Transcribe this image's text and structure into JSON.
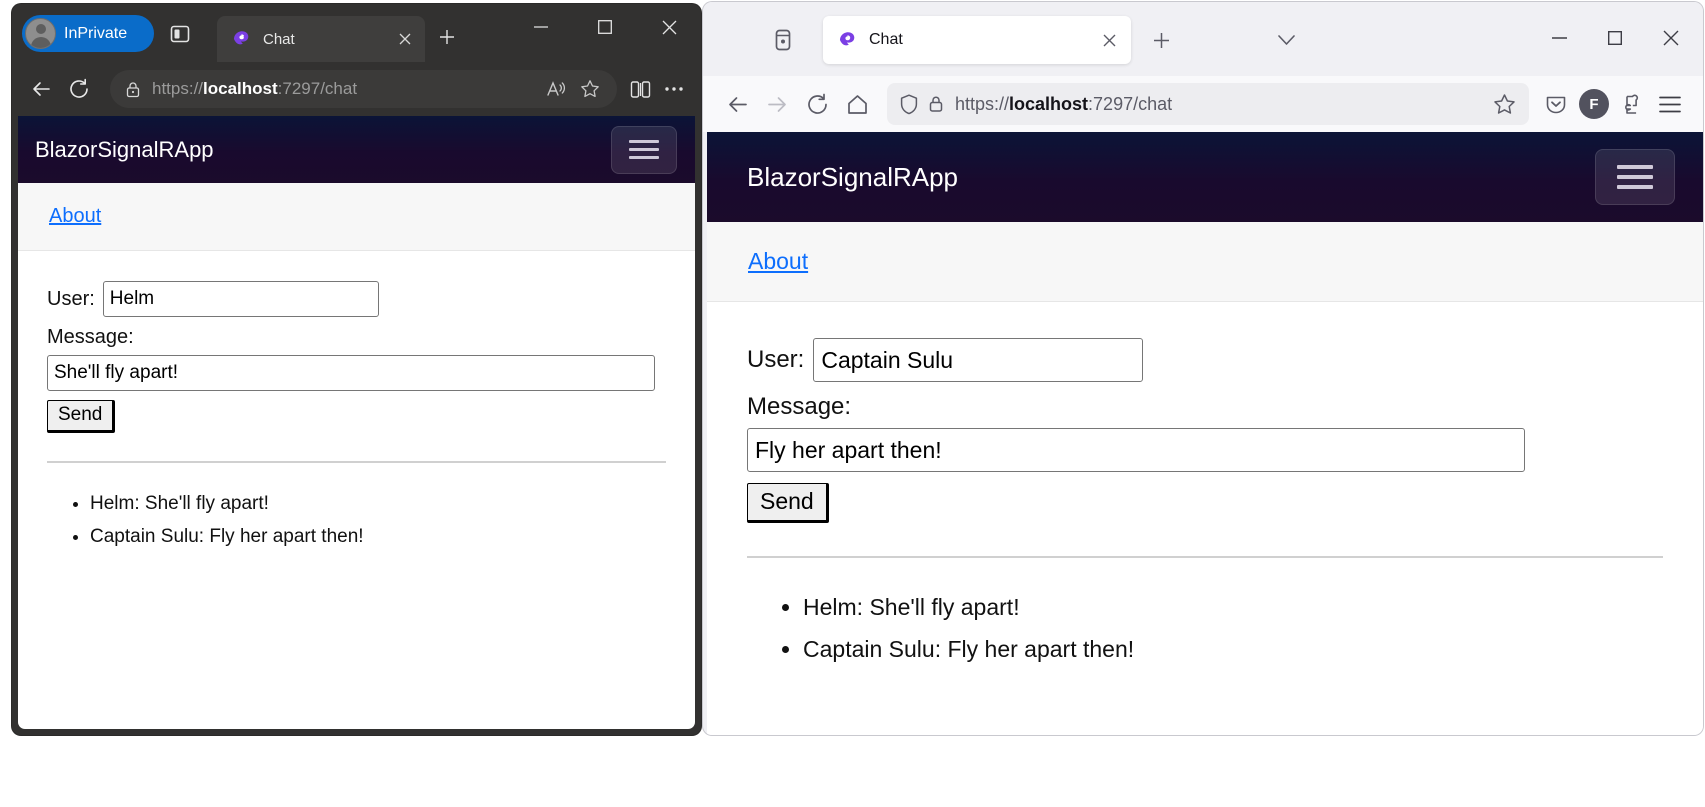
{
  "edge_window": {
    "profile_badge": "InPrivate",
    "icons": {
      "avatar": "avatar-icon",
      "split_screen": "split-screen-icon",
      "new_tab": "plus-icon",
      "minimize": "minimize-icon",
      "maximize": "maximize-icon",
      "close": "close-icon",
      "back": "back-arrow-icon",
      "reload": "reload-icon",
      "lock": "lock-icon",
      "read_aloud": "read-aloud-icon",
      "favorite": "star-icon",
      "split": "split-pane-icon",
      "more": "ellipsis-icon"
    },
    "tab": {
      "title": "Chat",
      "favicon": "blazor-favicon",
      "close_label": "×"
    },
    "address": {
      "scheme": "https://",
      "host": "localhost",
      "rest": ":7297/chat"
    }
  },
  "firefox_window": {
    "icons": {
      "firefox_view": "firefox-view-icon",
      "new_tab": "plus-icon",
      "list_all_tabs": "chevron-down-icon",
      "minimize": "minimize-icon",
      "maximize": "maximize-icon",
      "close": "close-icon",
      "back": "back-arrow-icon",
      "forward": "forward-arrow-icon",
      "reload": "reload-icon",
      "home": "home-icon",
      "shield": "shield-icon",
      "lock": "lock-icon",
      "bookmark": "star-icon",
      "pocket": "pocket-icon",
      "extensions": "extensions-icon",
      "app_menu": "hamburger-menu-icon"
    },
    "tab": {
      "title": "Chat",
      "favicon": "blazor-favicon",
      "close_label": "×"
    },
    "address": {
      "scheme": "https://",
      "host": "localhost",
      "rest": ":7297/chat"
    },
    "account_initial": "F"
  },
  "app": {
    "brand": "BlazorSignalRApp",
    "nav_link": "About",
    "menu_toggle": "navbar-toggler"
  },
  "edge_page": {
    "user_label": "User:",
    "user_value": "Helm",
    "message_label": "Message:",
    "message_value": "She'll fly apart!",
    "send_label": "Send",
    "messages": [
      "Helm: She'll fly apart!",
      "Captain Sulu: Fly her apart then!"
    ]
  },
  "firefox_page": {
    "user_label": "User:",
    "user_value": "Captain Sulu",
    "message_label": "Message:",
    "message_value": "Fly her apart then!",
    "send_label": "Send",
    "messages": [
      "Helm: She'll fly apart!",
      "Captain Sulu: Fly her apart then!"
    ]
  },
  "colors": {
    "edge_chrome": "#323130",
    "inprivate_blue": "#0a6cc9",
    "firefox_chrome": "#f0f0f4",
    "blazor_header_start": "#0b1437",
    "blazor_header_end": "#1b0b2b",
    "link_blue": "#0d6efd"
  }
}
